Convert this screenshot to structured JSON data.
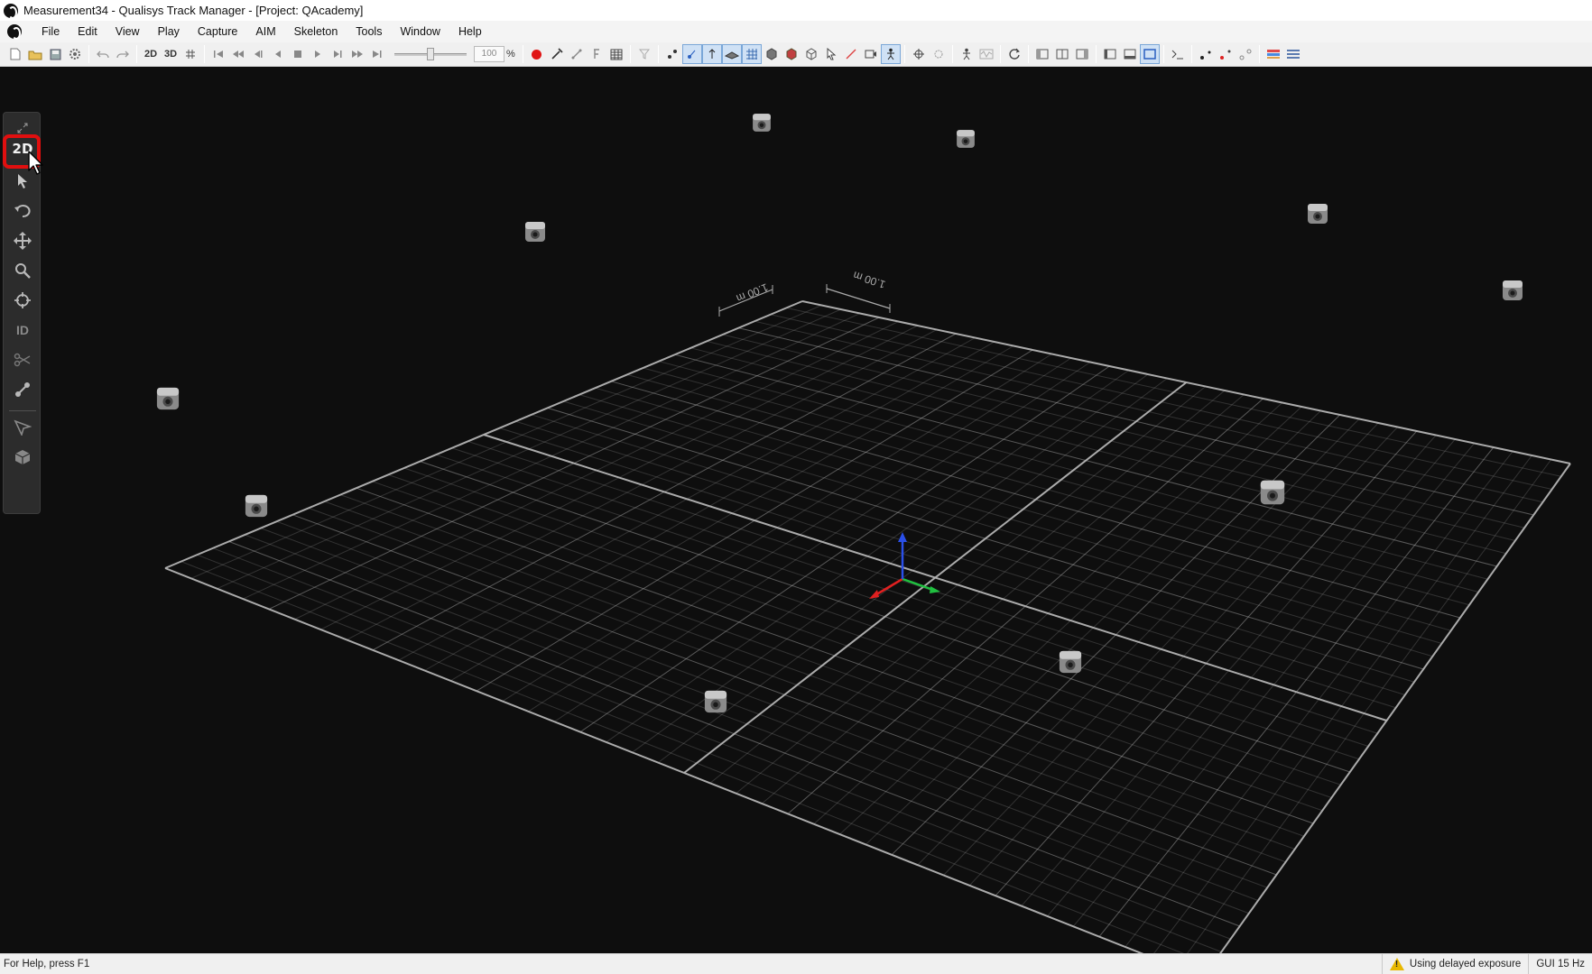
{
  "window": {
    "title": "Measurement34 - Qualisys Track Manager - [Project: QAcademy]"
  },
  "menu": {
    "items": [
      "File",
      "Edit",
      "View",
      "Play",
      "Capture",
      "AIM",
      "Skeleton",
      "Tools",
      "Window",
      "Help"
    ]
  },
  "toolbar": {
    "btn_2d": "2D",
    "btn_3d": "3D",
    "speed_value": "100",
    "speed_unit": "%",
    "record_color": "#e01515",
    "icons": [
      "new-file-icon",
      "open-folder-icon",
      "save-icon",
      "settings-gear-icon",
      "undo-icon",
      "redo-icon",
      "view-2d-button",
      "view-3d-button",
      "grid-view-icon",
      "go-start-icon",
      "step-back-fast-icon",
      "step-back-icon",
      "play-back-icon",
      "stop-icon",
      "play-icon",
      "step-forward-icon",
      "step-forward-fast-icon",
      "go-end-icon",
      "record-icon",
      "wand-icon",
      "bone-icon",
      "force-icon",
      "table-icon",
      "filter-icon"
    ]
  },
  "viewport": {
    "background": "#0e0e0e",
    "grid_color": "#b4b4b4",
    "axis_x_color": "#e02020",
    "axis_y_color": "#20c040",
    "axis_z_color": "#2a4fe8",
    "scale_label_left": "1.00 m",
    "scale_label_right": "1.00 m"
  },
  "left_toolbar": {
    "btn_2d": "2D",
    "btn_id": "ID",
    "highlight_color": "#e10f0f"
  },
  "statusbar": {
    "help_text": "For Help, press F1",
    "warning_text": "Using delayed exposure",
    "gui_rate": "GUI 15 Hz"
  }
}
